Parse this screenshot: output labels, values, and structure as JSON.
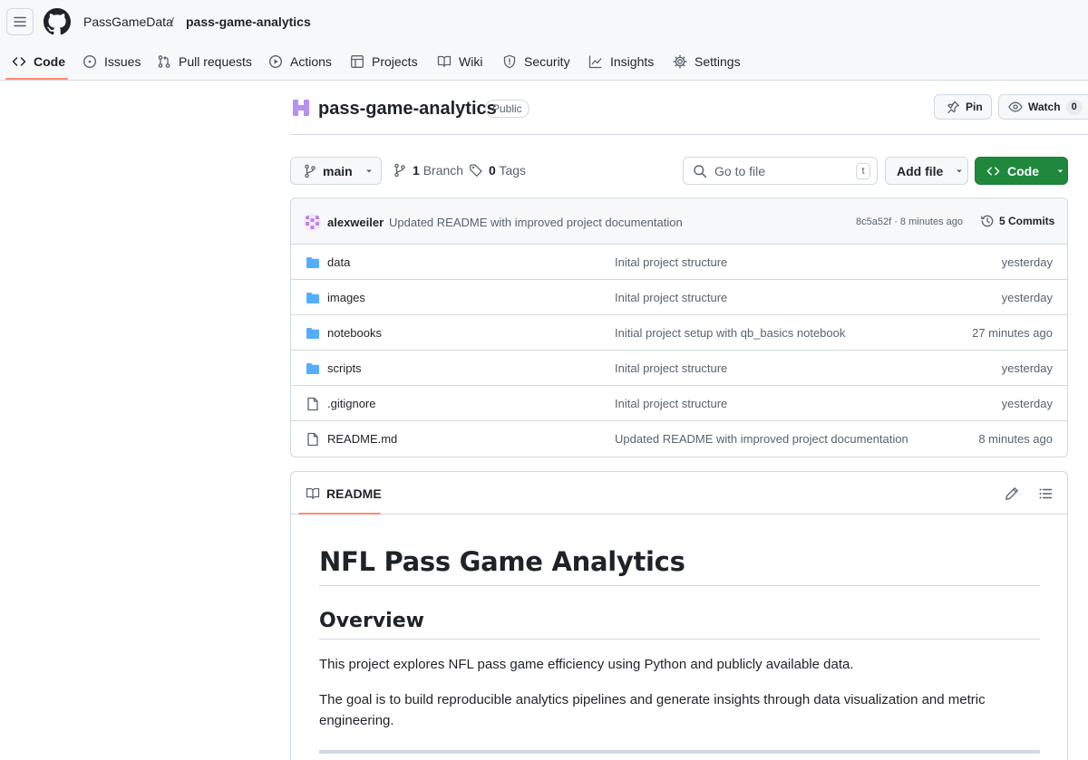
{
  "header": {
    "owner": "PassGameData",
    "separator": "/",
    "repo": "pass-game-analytics"
  },
  "tabs": [
    {
      "label": "Code",
      "icon": "code-icon",
      "active": true
    },
    {
      "label": "Issues",
      "icon": "issue-icon"
    },
    {
      "label": "Pull requests",
      "icon": "pull-request-icon"
    },
    {
      "label": "Actions",
      "icon": "play-icon"
    },
    {
      "label": "Projects",
      "icon": "table-icon"
    },
    {
      "label": "Wiki",
      "icon": "book-icon"
    },
    {
      "label": "Security",
      "icon": "shield-icon"
    },
    {
      "label": "Insights",
      "icon": "graph-icon"
    },
    {
      "label": "Settings",
      "icon": "gear-icon"
    }
  ],
  "repo": {
    "title": "pass-game-analytics",
    "visibility": "Public",
    "pin_label": "Pin",
    "watch_label": "Watch",
    "watch_count": "0"
  },
  "controls": {
    "branch": "main",
    "branch_count": "1",
    "branch_label": "Branch",
    "tag_count": "0",
    "tag_label": "Tags",
    "goto_placeholder": "Go to file",
    "goto_key": "t",
    "add_file": "Add file",
    "code": "Code"
  },
  "commit": {
    "author": "alexweiler",
    "message": "Updated README with improved project documentation",
    "sha_time": "8c5a52f · 8 minutes ago",
    "count_label": "5 Commits"
  },
  "files": [
    {
      "name": "data",
      "type": "folder",
      "message": "Inital project structure",
      "time": "yesterday"
    },
    {
      "name": "images",
      "type": "folder",
      "message": "Inital project structure",
      "time": "yesterday"
    },
    {
      "name": "notebooks",
      "type": "folder",
      "message": "Initial project setup with qb_basics notebook",
      "time": "27 minutes ago"
    },
    {
      "name": "scripts",
      "type": "folder",
      "message": "Inital project structure",
      "time": "yesterday"
    },
    {
      "name": ".gitignore",
      "type": "file",
      "message": "Inital project structure",
      "time": "yesterday"
    },
    {
      "name": "README.md",
      "type": "file",
      "message": "Updated README with improved project documentation",
      "time": "8 minutes ago"
    }
  ],
  "readme": {
    "tab_label": "README",
    "h1": "NFL Pass Game Analytics",
    "h2": "Overview",
    "p1": "This project explores NFL pass game efficiency using Python and publicly available data.",
    "p2": "The goal is to build reproducible analytics pipelines and generate insights through data visualization and metric engineering."
  },
  "colors": {
    "accent_green": "#1f883d",
    "tab_underline": "#fd8c73",
    "folder_blue": "#54aeff"
  }
}
